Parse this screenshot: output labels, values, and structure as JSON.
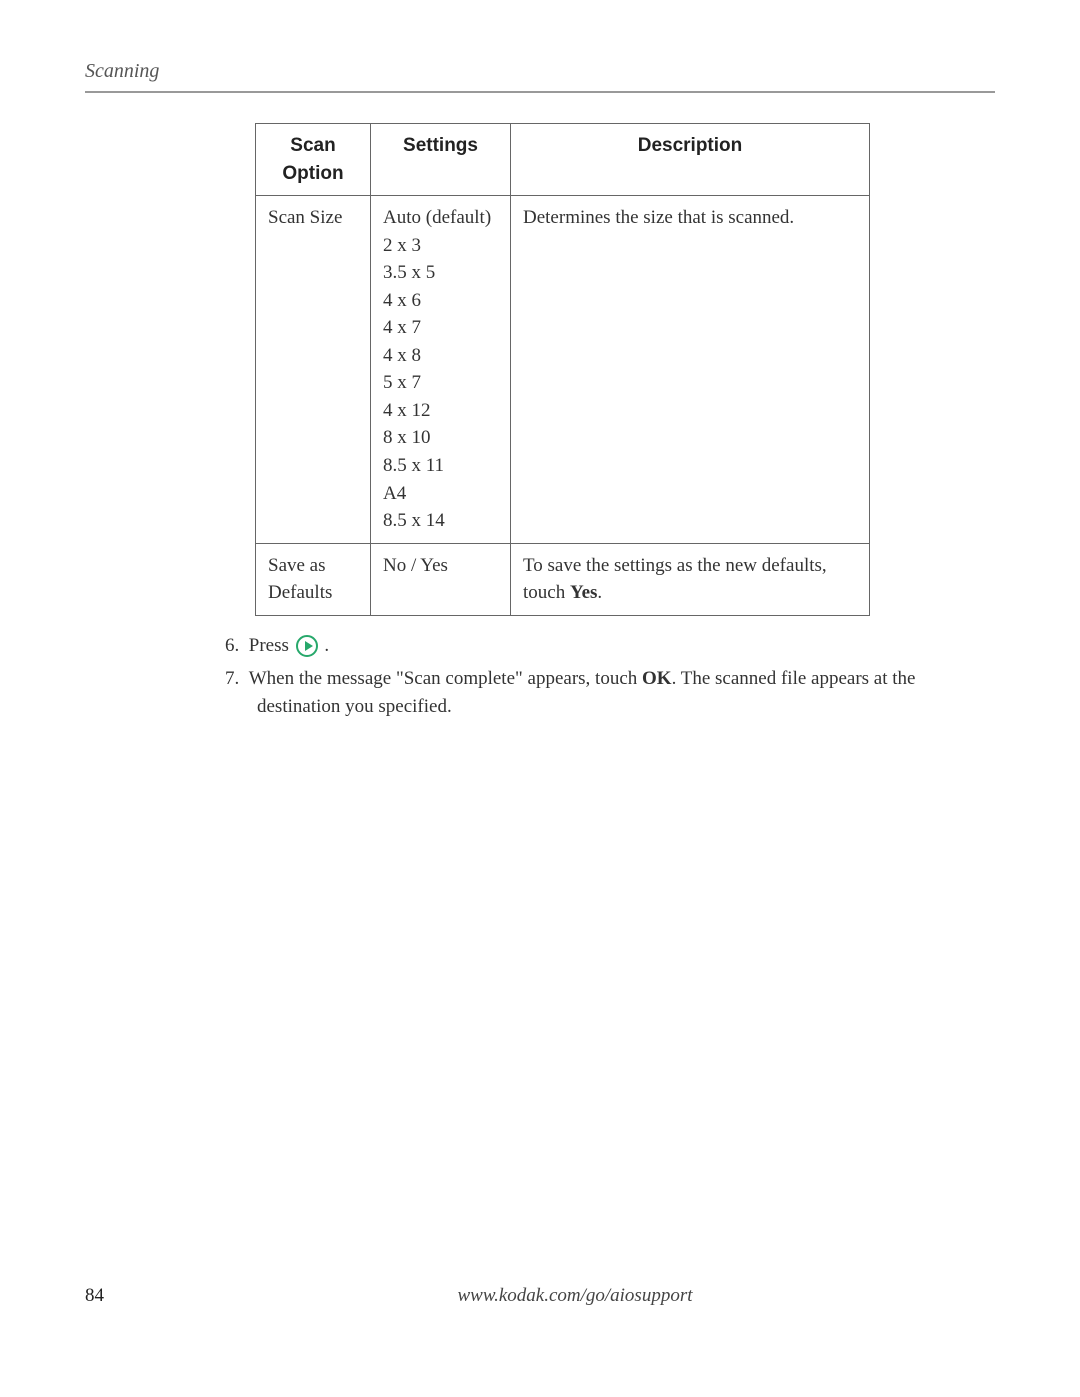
{
  "header": {
    "section_title": "Scanning"
  },
  "table": {
    "headers": {
      "option": "Scan Option",
      "settings": "Settings",
      "description": "Description"
    },
    "rows": [
      {
        "option": "Scan Size",
        "settings": [
          "Auto (default)",
          "2 x 3",
          "3.5 x 5",
          "4 x 6",
          "4 x 7",
          "4 x 8",
          "5 x 7",
          "4 x 12",
          "8 x 10",
          "8.5 x 11",
          "A4",
          "8.5 x 14"
        ],
        "description": "Determines the size that is scanned."
      },
      {
        "option": "Save as Defaults",
        "settings": [
          "No / Yes"
        ],
        "description_pre": "To save the settings as the new defaults, touch ",
        "description_bold": "Yes",
        "description_post": "."
      }
    ]
  },
  "steps": {
    "s6_num": "6.",
    "s6_pre": "Press ",
    "s6_post": " .",
    "s7_num": "7.",
    "s7_pre": "When the message \"Scan complete\" appears, touch ",
    "s7_bold": "OK",
    "s7_post": ". The scanned file appears at the destination you specified."
  },
  "footer": {
    "page_number": "84",
    "url": "www.kodak.com/go/aiosupport"
  }
}
